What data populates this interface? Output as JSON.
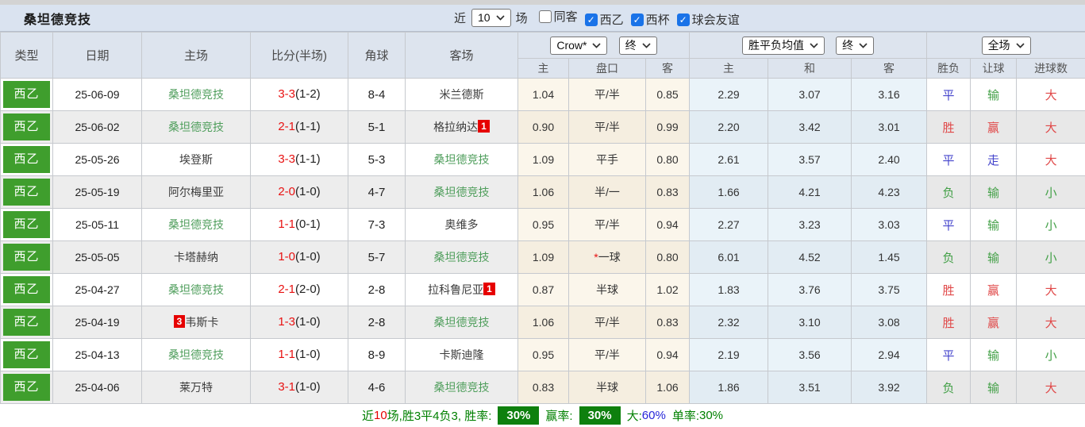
{
  "title": "桑坦德竞技",
  "colors": {
    "league_badge_green": "#3f9e2d",
    "self_team_green": "#4f9e5c",
    "score_red": "#e81212",
    "result_red": "#e04848",
    "result_blue": "#4545cc",
    "result_green": "#43a047",
    "inline_badge_red": "#e60000",
    "summary_green": "#008000",
    "summary_badge_green": "#0e800e",
    "rate_blue": "#2626d9",
    "checkbox_blue": "#1a73e8"
  },
  "filters": {
    "recent_label": "近",
    "recent_value": "10",
    "matches_label": "场",
    "checkboxes": [
      {
        "label": "同客",
        "checked": false
      },
      {
        "label": "西乙",
        "checked": true
      },
      {
        "label": "西杯",
        "checked": true
      },
      {
        "label": "球会友谊",
        "checked": true
      }
    ]
  },
  "table": {
    "left_headers": [
      "类型",
      "日期",
      "主场",
      "比分(半场)",
      "角球",
      "客场"
    ],
    "selects": {
      "company": "Crow*",
      "company_state": "终",
      "avg": "胜平负均值",
      "avg_state": "终",
      "scope": "全场"
    },
    "subheaders": [
      "主",
      "盘口",
      "客",
      "主",
      "和",
      "客",
      "胜负",
      "让球",
      "进球数"
    ]
  },
  "rows": [
    {
      "league": "西乙",
      "date": "25-06-09",
      "home": {
        "name": "桑坦德竞技",
        "self": true
      },
      "score_ft": "3-3",
      "score_ht": "(1-2)",
      "corners": "8-4",
      "away": {
        "name": "米兰德斯",
        "self": false
      },
      "odds": [
        "1.04",
        "平/半",
        "0.85"
      ],
      "handicap_star": false,
      "avg": [
        "2.29",
        "3.07",
        "3.16"
      ],
      "results": [
        {
          "text": "平",
          "color": "blue"
        },
        {
          "text": "输",
          "color": "green"
        },
        {
          "text": "大",
          "color": "red"
        }
      ]
    },
    {
      "league": "西乙",
      "date": "25-06-02",
      "home": {
        "name": "桑坦德竞技",
        "self": true
      },
      "score_ft": "2-1",
      "score_ht": "(1-1)",
      "corners": "5-1",
      "away": {
        "name": "格拉纳达",
        "self": false,
        "badge": "1",
        "badge_pos": "after"
      },
      "odds": [
        "0.90",
        "平/半",
        "0.99"
      ],
      "handicap_star": false,
      "avg": [
        "2.20",
        "3.42",
        "3.01"
      ],
      "results": [
        {
          "text": "胜",
          "color": "red"
        },
        {
          "text": "赢",
          "color": "red"
        },
        {
          "text": "大",
          "color": "red"
        }
      ]
    },
    {
      "league": "西乙",
      "date": "25-05-26",
      "home": {
        "name": "埃登斯",
        "self": false
      },
      "score_ft": "3-3",
      "score_ht": "(1-1)",
      "corners": "5-3",
      "away": {
        "name": "桑坦德竞技",
        "self": true
      },
      "odds": [
        "1.09",
        "平手",
        "0.80"
      ],
      "handicap_star": false,
      "avg": [
        "2.61",
        "3.57",
        "2.40"
      ],
      "results": [
        {
          "text": "平",
          "color": "blue"
        },
        {
          "text": "走",
          "color": "blue"
        },
        {
          "text": "大",
          "color": "red"
        }
      ]
    },
    {
      "league": "西乙",
      "date": "25-05-19",
      "home": {
        "name": "阿尔梅里亚",
        "self": false
      },
      "score_ft": "2-0",
      "score_ht": "(1-0)",
      "corners": "4-7",
      "away": {
        "name": "桑坦德竞技",
        "self": true
      },
      "odds": [
        "1.06",
        "半/一",
        "0.83"
      ],
      "handicap_star": false,
      "avg": [
        "1.66",
        "4.21",
        "4.23"
      ],
      "results": [
        {
          "text": "负",
          "color": "green"
        },
        {
          "text": "输",
          "color": "green"
        },
        {
          "text": "小",
          "color": "green"
        }
      ]
    },
    {
      "league": "西乙",
      "date": "25-05-11",
      "home": {
        "name": "桑坦德竞技",
        "self": true
      },
      "score_ft": "1-1",
      "score_ht": "(0-1)",
      "corners": "7-3",
      "away": {
        "name": "奥维多",
        "self": false
      },
      "odds": [
        "0.95",
        "平/半",
        "0.94"
      ],
      "handicap_star": false,
      "avg": [
        "2.27",
        "3.23",
        "3.03"
      ],
      "results": [
        {
          "text": "平",
          "color": "blue"
        },
        {
          "text": "输",
          "color": "green"
        },
        {
          "text": "小",
          "color": "green"
        }
      ]
    },
    {
      "league": "西乙",
      "date": "25-05-05",
      "home": {
        "name": "卡塔赫纳",
        "self": false
      },
      "score_ft": "1-0",
      "score_ht": "(1-0)",
      "corners": "5-7",
      "away": {
        "name": "桑坦德竞技",
        "self": true
      },
      "odds": [
        "1.09",
        "一球",
        "0.80"
      ],
      "handicap_star": true,
      "avg": [
        "6.01",
        "4.52",
        "1.45"
      ],
      "results": [
        {
          "text": "负",
          "color": "green"
        },
        {
          "text": "输",
          "color": "green"
        },
        {
          "text": "小",
          "color": "green"
        }
      ]
    },
    {
      "league": "西乙",
      "date": "25-04-27",
      "home": {
        "name": "桑坦德竞技",
        "self": true
      },
      "score_ft": "2-1",
      "score_ht": "(2-0)",
      "corners": "2-8",
      "away": {
        "name": "拉科鲁尼亚",
        "self": false,
        "badge": "1",
        "badge_pos": "after"
      },
      "odds": [
        "0.87",
        "半球",
        "1.02"
      ],
      "handicap_star": false,
      "avg": [
        "1.83",
        "3.76",
        "3.75"
      ],
      "results": [
        {
          "text": "胜",
          "color": "red"
        },
        {
          "text": "赢",
          "color": "red"
        },
        {
          "text": "大",
          "color": "red"
        }
      ]
    },
    {
      "league": "西乙",
      "date": "25-04-19",
      "home": {
        "name": "韦斯卡",
        "self": false,
        "badge": "3",
        "badge_pos": "before"
      },
      "score_ft": "1-3",
      "score_ht": "(1-0)",
      "corners": "2-8",
      "away": {
        "name": "桑坦德竞技",
        "self": true
      },
      "odds": [
        "1.06",
        "平/半",
        "0.83"
      ],
      "handicap_star": false,
      "avg": [
        "2.32",
        "3.10",
        "3.08"
      ],
      "results": [
        {
          "text": "胜",
          "color": "red"
        },
        {
          "text": "赢",
          "color": "red"
        },
        {
          "text": "大",
          "color": "red"
        }
      ]
    },
    {
      "league": "西乙",
      "date": "25-04-13",
      "home": {
        "name": "桑坦德竞技",
        "self": true
      },
      "score_ft": "1-1",
      "score_ht": "(1-0)",
      "corners": "8-9",
      "away": {
        "name": "卡斯迪隆",
        "self": false
      },
      "odds": [
        "0.95",
        "平/半",
        "0.94"
      ],
      "handicap_star": false,
      "avg": [
        "2.19",
        "3.56",
        "2.94"
      ],
      "results": [
        {
          "text": "平",
          "color": "blue"
        },
        {
          "text": "输",
          "color": "green"
        },
        {
          "text": "小",
          "color": "green"
        }
      ]
    },
    {
      "league": "西乙",
      "date": "25-04-06",
      "home": {
        "name": "莱万特",
        "self": false
      },
      "score_ft": "3-1",
      "score_ht": "(1-0)",
      "corners": "4-6",
      "away": {
        "name": "桑坦德竞技",
        "self": true
      },
      "odds": [
        "0.83",
        "半球",
        "1.06"
      ],
      "handicap_star": false,
      "avg": [
        "1.86",
        "3.51",
        "3.92"
      ],
      "results": [
        {
          "text": "负",
          "color": "green"
        },
        {
          "text": "输",
          "color": "green"
        },
        {
          "text": "大",
          "color": "red"
        }
      ]
    }
  ],
  "summary": {
    "recent_label": "近",
    "count": "10",
    "stats_text": "场,胜3平4负3, 胜率:",
    "win_rate": "30%",
    "profit_label": "赢率:",
    "profit_rate": "30%",
    "big_label": "大:",
    "big_rate": "60%",
    "single_label": "单率:",
    "single_rate": "30%"
  }
}
